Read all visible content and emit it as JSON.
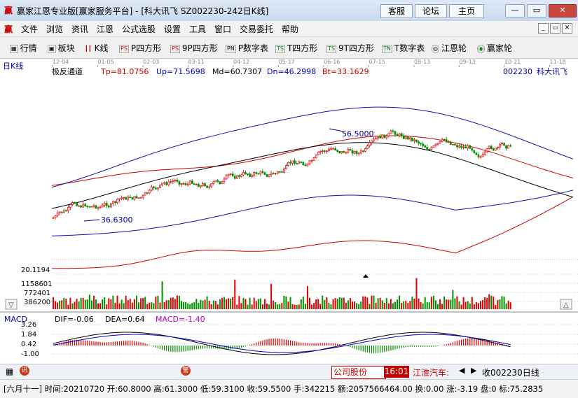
{
  "window": {
    "title": "赢家江恩专业版[赢家服务平台] - [科大讯飞  SZ002230-242日K线]",
    "buttons": [
      "客服",
      "论坛",
      "主页"
    ],
    "controls": {
      "minimize": "—",
      "maximize": "▭",
      "close": "✕"
    }
  },
  "menu": [
    "文件",
    "浏览",
    "资讯",
    "江恩",
    "公式选股",
    "设置",
    "工具",
    "窗口",
    "交易委托",
    "帮助"
  ],
  "toolbar": [
    "行情",
    "板块",
    "K线",
    "P四方形",
    "9P四方形",
    "P数字表",
    "T四方形",
    "9T四方形",
    "T数字表",
    "江恩轮",
    "赢家轮"
  ],
  "chart": {
    "period_label": "日K线",
    "date_ticks": [
      "12-04",
      "01-05",
      "02-03",
      "03-11",
      "04-12",
      "05-17",
      "06-16",
      "07-15",
      "08-13",
      "09-13",
      "10-21",
      "11-18"
    ],
    "indicator_name": "极反通道",
    "tp": "Tp=81.0756",
    "up": "Up=71.5698",
    "md": "Md=60.7307",
    "dn": "Dn=46.2998",
    "bt": "Bt=33.1629",
    "stock_code": "002230",
    "stock_name": "科大讯飞",
    "high_label": "56.5000",
    "low_label": "36.6300"
  },
  "volume": {
    "scale": [
      "20.1194",
      "1158601",
      "772401",
      "386200"
    ]
  },
  "macd": {
    "name": "MACD",
    "dif": "DIF=-0.06",
    "dea": "DEA=0.64",
    "macd": "MACD=-1.40",
    "scale": [
      "3.26",
      "1.84",
      "0.42",
      "-1.00"
    ]
  },
  "bottombar": {
    "ticker1_name": "公司股份",
    "time": "16:01",
    "ticker2_name": "江淮汽车:",
    "ticker2_value": "收002230日线"
  },
  "status": "[六月十一] 时间:20210720 开:60.8000 高:61.3000 低:59.3100 收:59.5500 手:342215 额:2057566464.00 换:0.00 涨:-3.19 盘:0 标:75.2835",
  "colors": {
    "up": "#e00000",
    "down": "#008000",
    "channel_outer": "#d00000",
    "channel_inner": "#0000b0",
    "mid": "#000000"
  }
}
